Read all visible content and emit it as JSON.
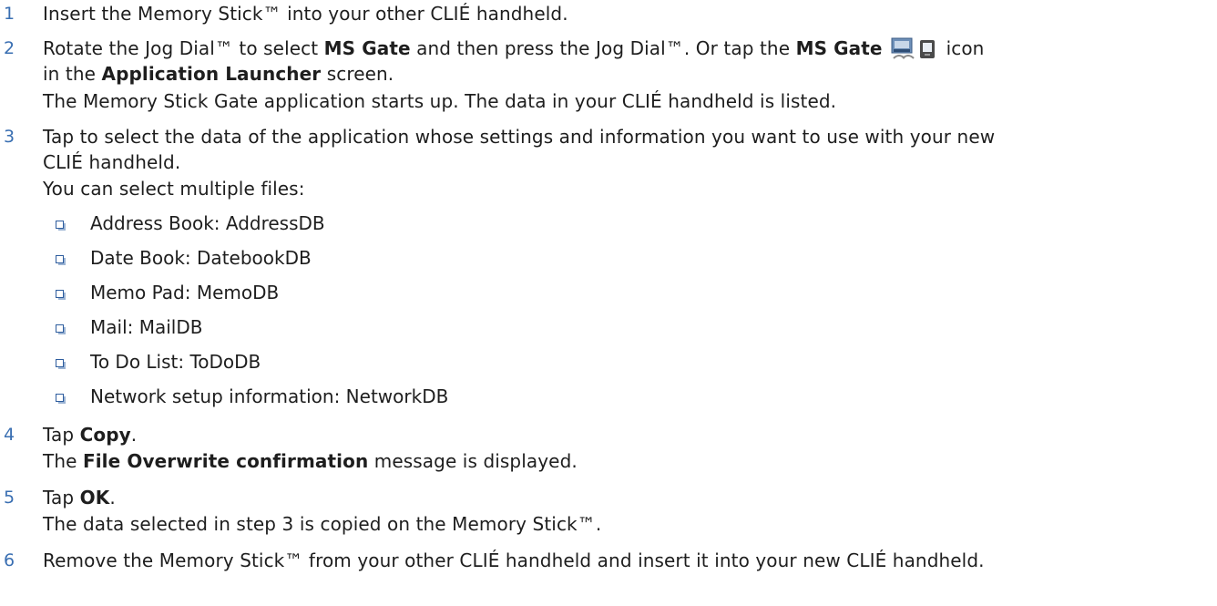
{
  "colors": {
    "step_number": "#3a6fb2",
    "text": "#1e1e1e",
    "bullet": "#2e5d9e"
  },
  "steps": [
    {
      "number": "1",
      "text": "Insert the Memory Stick™ into your other CLIÉ handheld."
    },
    {
      "number": "2",
      "a": "Rotate the Jog Dial™ to select ",
      "b": "MS Gate",
      "c": " and then press the Jog Dial™. Or tap the ",
      "d": "MS Gate",
      "e": "icon",
      "f": "in the ",
      "g": "Application Launcher",
      "h": " screen.",
      "result": "The Memory Stick Gate application starts up. The data in your CLIÉ handheld is listed.",
      "icon": "ms-gate-icon"
    },
    {
      "number": "3",
      "line1": "Tap to select the data of the application whose settings and information you want to use with your new",
      "line2": "CLIÉ handheld.",
      "line3": "You can select multiple files:",
      "items": [
        "Address Book: AddressDB",
        "Date Book: DatebookDB",
        "Memo Pad: MemoDB",
        "Mail: MailDB",
        "To Do List: ToDoDB",
        "Network setup information: NetworkDB"
      ]
    },
    {
      "number": "4",
      "a": "Tap ",
      "b": "Copy",
      "c": ".",
      "d": "The ",
      "e": "File Overwrite confirmation",
      "f": " message is displayed."
    },
    {
      "number": "5",
      "a": "Tap ",
      "b": "OK",
      "c": ".",
      "result": "The data selected in step 3 is copied on the Memory Stick™."
    },
    {
      "number": "6",
      "text": "Remove the Memory Stick™ from your other CLIÉ handheld and insert it into your new CLIÉ handheld."
    }
  ]
}
